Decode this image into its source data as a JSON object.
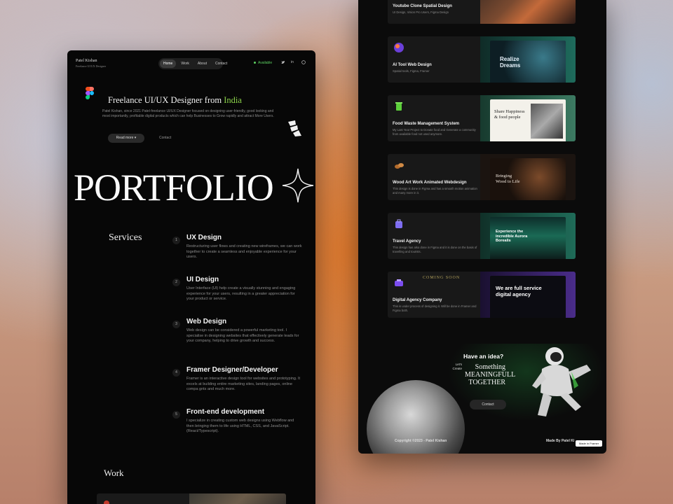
{
  "left": {
    "brand": {
      "name": "Patel Kishan",
      "subtitle": "Freelance UI/UX Designer"
    },
    "nav": [
      "Home",
      "Work",
      "About",
      "Contact"
    ],
    "available": "Available",
    "social": [
      "tw",
      "in",
      "dr"
    ],
    "headline": {
      "prefix": "Freelance UI/UX Designer  from ",
      "country": "India"
    },
    "intro": "Patel Kishan, since 2021 Patel-freelance UI/UX Designer focused on designing user-friendly, good looking and most importantly, profitable digital products which can help Businesses to Grow rapidly and attract More Users.",
    "read_more": "Read more",
    "contact_link": "Contact",
    "portfolio_word": "PORTFOLIO",
    "services_title": "Services",
    "services": [
      {
        "num": "1",
        "title": "UX Design",
        "desc": "Restructuring user flows and creating new wireframes, we can work together to create a seamless and enjoyable experience for your users."
      },
      {
        "num": "2",
        "title": "UI Design",
        "desc": "User Interface (UI) help create a visually stunning and engaging experience for your users, resulting in a greater appreciation for your product or service."
      },
      {
        "num": "3",
        "title": "Web Design",
        "desc": "Web design can be considered a powerful marketing tool. I specialise in designing websites that effectively generate leads for your company, helping to drive growth and success."
      },
      {
        "num": "4",
        "title": "Framer Designer/Developer",
        "desc": "Framer is an interactive design tool for websites and prototyping. It excels at building entire marketing sites, landing pages, online compa gnts and much more."
      },
      {
        "num": "5",
        "title": "Front-end development",
        "desc": "I specialize in creating custom web designs using Webflow and then bringing them to life using HTML, CSS, and JavaScript. (React/Typescript)."
      }
    ],
    "work_title": "Work"
  },
  "right": {
    "projects": [
      {
        "title": "Youtube Clone Spatial Design",
        "desc": "UI Design, Vision Pro Users, Figma Design",
        "icon": "youtube-icon",
        "shot_text": ""
      },
      {
        "title": "AI Tool Web Design",
        "desc": "Spatial tools, Figma, Framer",
        "icon": "ai-orb-icon",
        "shot_text": "Realize Dreams"
      },
      {
        "title": "Food Waste Management System",
        "desc": "My Last Year Project to Donate food and Generate a community from available food not used anymore.",
        "icon": "food-bin-icon",
        "shot_text": "Share Happiness & food people"
      },
      {
        "title": "Wood Art Work Animated Webdesign",
        "desc": "This design is done in Figma and has a smooth motion animation and many more in it.",
        "icon": "wood-logs-icon",
        "shot_text": "Bringing Wood to Life"
      },
      {
        "title": "Travel Agency",
        "desc": "This design has also done in Figma and it is done on the basis of travelling and tourists.",
        "icon": "suitcase-icon",
        "shot_text": "Experience the incredible Aurora Borealis"
      },
      {
        "title": "Digital Agency Company",
        "desc": "This is under process of designing it. Will be done in Framer and Figma both.",
        "icon": "agency-icon",
        "shot_text": "We are full service digital agency",
        "badge": "COMING SOON"
      }
    ],
    "cta": {
      "question": "Have an idea?",
      "lets": "Let's Create",
      "line1": "Something",
      "line2": "MEANINGFULL",
      "line3": "TOGETHER",
      "button": "Contact"
    },
    "footer": {
      "copyright": "Copyright ©2023 - Patel Kishan",
      "made_by": "Made By Patel Ki",
      "badge": "Made in Framer"
    }
  }
}
